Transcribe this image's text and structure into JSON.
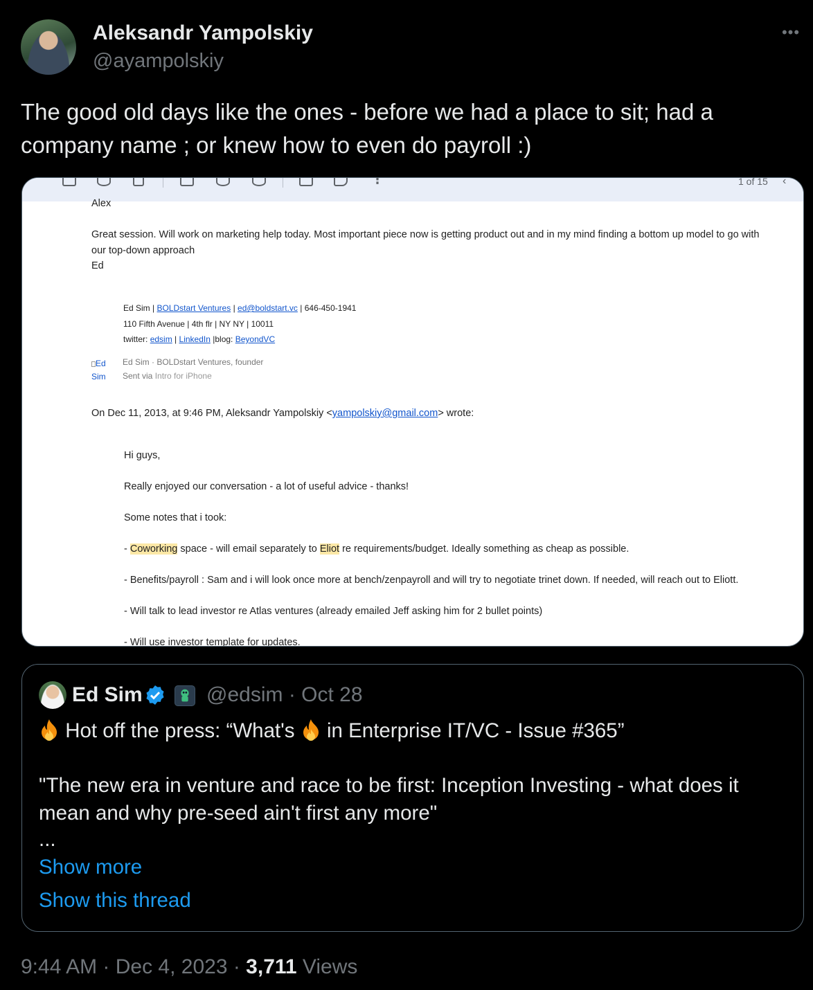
{
  "author": {
    "display_name": "Aleksandr Yampolskiy",
    "handle": "@ayampolskiy"
  },
  "more_icon": "more-horizontal-icon",
  "tweet_text": "The good old days like the ones - before we had a place to sit; had a company name ; or knew how to even do payroll :)",
  "media": {
    "toolbar": {
      "icons": [
        "archive-icon",
        "report-spam-icon",
        "delete-icon",
        "mark-unread-icon",
        "snooze-icon",
        "add-task-icon",
        "move-to-icon",
        "label-icon",
        "more-vertical-icon"
      ],
      "pager": "1 of 15"
    },
    "email": {
      "greeting": "Alex",
      "body_line1": "Great session. Will work on marketing help today. Most important piece now is getting product out and in my mind finding a bottom up model to go with",
      "body_line2": "our top-down approach",
      "signoff": "Ed",
      "sig_name": "Ed Sim",
      "sig_sep": "|",
      "sig_company": "BOLDstart Ventures",
      "sig_email": "ed@boldstart.vc",
      "sig_phone": "646-450-1941",
      "sig_address": "110 Fifth Avenue | 4th flr | NY NY | 10011",
      "sig_twitter_label": "twitter:",
      "sig_twitter": "edsim",
      "sig_linkedin": "LinkedIn",
      "sig_blog_label": "blog:",
      "sig_blog": "BeyondVC",
      "img_alt_1": "Ed",
      "img_alt_2": "Sim",
      "intro_line1": "Ed Sim · BOLDstart Ventures, founder",
      "intro_sent_via": "Sent via",
      "intro_app": "Intro for iPhone",
      "quoted_header_pre": "On Dec 11, 2013, at 9:46 PM, Aleksandr Yampolskiy <",
      "quoted_header_email": "yampolskiy@gmail.com",
      "quoted_header_post": "> wrote:",
      "q_hi": "Hi guys,",
      "q_enjoyed": "Really enjoyed our conversation - a lot of useful advice - thanks!",
      "q_notes": "Some notes that i took:",
      "q_cowork_pre": "- ",
      "q_cowork_hl": "Coworking",
      "q_cowork_mid": " space - will email separately to ",
      "q_cowork_hl2": "Eliot",
      "q_cowork_post": " re requirements/budget. Ideally something as cheap as possible.",
      "q_benefits": "- Benefits/payroll : Sam and i will look once more at bench/zenpayroll and will try to negotiate trinet down. If needed, will reach out to Eliott.",
      "q_investor": "- Will talk to lead investor re Atlas ventures (already emailed Jeff asking him for 2 bullet points)",
      "q_template": "- Will use investor template for updates."
    }
  },
  "quoted_tweet": {
    "display_name": "Ed Sim",
    "handle_date": "@edsim · Oct 28",
    "headline_1": "Hot off the press: “What's",
    "headline_2": "in Enterprise IT/VC - Issue #365”",
    "quote": "\"The new era in venture and race to be first: Inception Investing - what does it mean and why pre-seed ain't first any more\"",
    "ellipsis": "...",
    "show_more": "Show more",
    "show_thread": "Show this thread"
  },
  "meta": {
    "time_date": "9:44 AM · Dec 4, 2023 · ",
    "views_count": "3,711",
    "views_label": " Views"
  },
  "colors": {
    "background": "#000000",
    "text": "#e7e9ea",
    "secondary": "#71767b",
    "link": "#1d9bf0",
    "border": "#536471"
  }
}
